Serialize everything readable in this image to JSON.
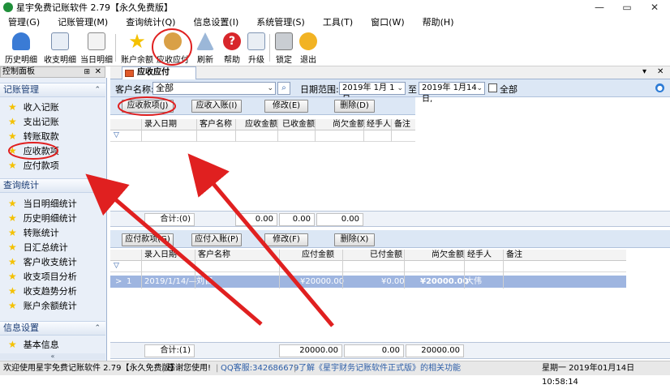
{
  "window": {
    "title": "星宇免费记账软件 2.79【永久免费版】",
    "minimize": "—",
    "maximize": "▭",
    "close": "✕"
  },
  "menu": [
    "管理(G)",
    "记账管理(M)",
    "查询统计(Q)",
    "信息设置(I)",
    "系统管理(S)",
    "工具(T)",
    "窗口(W)",
    "帮助(H)"
  ],
  "toolbar": [
    "历史明细",
    "收支明细",
    "当日明细",
    "账户余额",
    "应收应付",
    "刷新",
    "帮助",
    "升级",
    "锁定",
    "退出"
  ],
  "control_panel": {
    "title": "控制面板",
    "pin": "⊞",
    "close": "✕"
  },
  "sidebar": {
    "groups": [
      {
        "title": "记账管理",
        "items": [
          "收入记账",
          "支出记账",
          "转账取款",
          "应收款项",
          "应付款项"
        ]
      },
      {
        "title": "查询统计",
        "items": [
          "当日明细统计",
          "历史明细统计",
          "转账统计",
          "日汇总统计",
          "客户收支统计",
          "收支项目分析",
          "收支趋势分析",
          "账户余额统计"
        ]
      },
      {
        "title": "信息设置",
        "items": [
          "基本信息"
        ]
      }
    ],
    "chevron": "«"
  },
  "tab": {
    "label": "应收应付"
  },
  "filter": {
    "customer_label": "客户名称:",
    "customer_value": "全部",
    "date_label": "日期范围:",
    "date_from": "2019年 1月 1日,",
    "to_label": "至",
    "date_to": "2019年 1月14日,",
    "all_label": "全部"
  },
  "receivable": {
    "buttons": [
      "应收款项(J)",
      "应收入账(I)",
      "修改(E)",
      "删除(D)"
    ],
    "columns": [
      "录入日期",
      "客户名称",
      "应收金额",
      "已收金额",
      "尚欠金额",
      "经手人",
      "备注"
    ],
    "total_label": "合计:(0)",
    "totals": [
      "0.00",
      "0.00",
      "0.00"
    ]
  },
  "payable": {
    "buttons": [
      "应付款项(G)",
      "应付入账(P)",
      "修改(F)",
      "删除(X)"
    ],
    "columns": [
      "录入日期",
      "客户名称",
      "应付金额",
      "已付金额",
      "尚欠金额",
      "经手人",
      "备注"
    ],
    "rows": [
      {
        "marker": ">",
        "no": "1",
        "date": "2019/1/14/—",
        "customer": "刘官",
        "payable": "¥20000.00",
        "paid": "¥0.00",
        "owed": "¥20000.00",
        "handler": "大伟",
        "note": ""
      }
    ],
    "total_label": "合计:(1)",
    "totals": [
      "20000.00",
      "0.00",
      "20000.00"
    ]
  },
  "status": {
    "welcome": "欢迎使用星宇免费记账软件 2.79【永久免费版】",
    "thanks": "感谢您使用!",
    "qq": "QQ客服:342686679",
    "link": "了解《星宇财务记账软件正式版》的相关功能",
    "datetime": "星期一 2019年01月14日 10:58:14"
  },
  "colors": {
    "accent": "#1b3d75",
    "annotation": "#e02020",
    "row_selected": "#9eb5e0"
  }
}
